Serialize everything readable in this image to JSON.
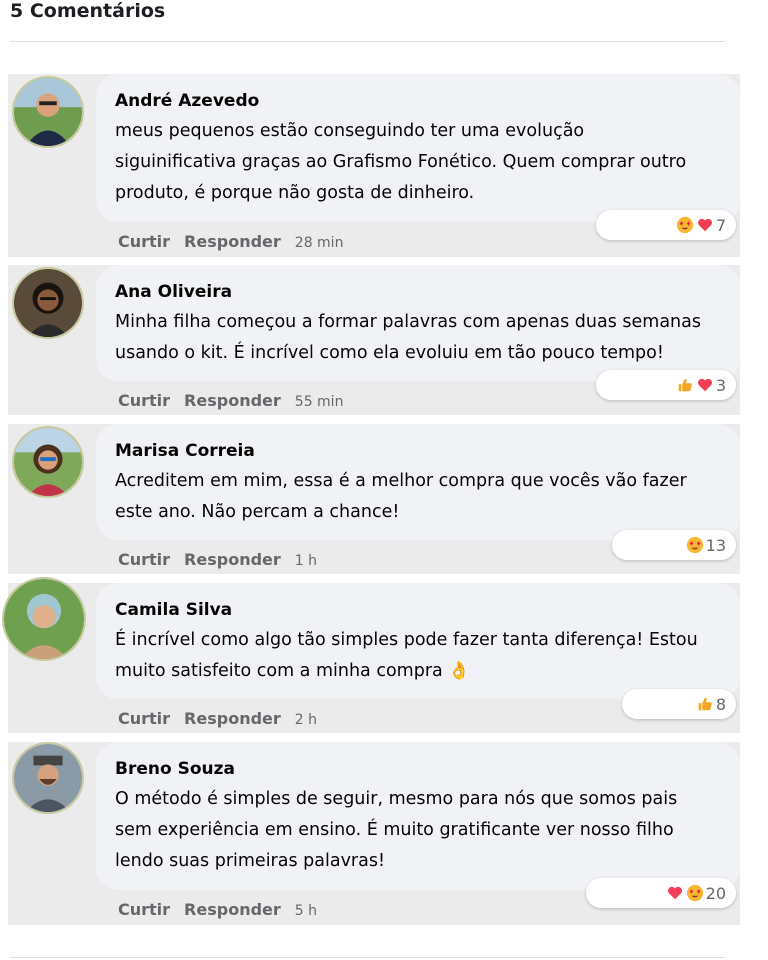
{
  "header": {
    "title": "5 Comentários"
  },
  "actions": {
    "like": "Curtir",
    "reply": "Responder"
  },
  "comments": [
    {
      "name": "André Azevedo",
      "lines": [
        "meus pequenos estão conseguindo ter uma evolução",
        "siguinificativa graças ao Grafismo Fonético. Quem comprar outro",
        "produto, é porque não gosta de dinheiro."
      ],
      "time": "28 min",
      "reactions": [
        "heart-eyes-emoji",
        "heart-icon"
      ],
      "count": "7"
    },
    {
      "name": "Ana Oliveira",
      "lines": [
        "Minha filha começou a formar palavras com apenas duas semanas",
        "usando o kit. É incrível como ela evoluiu em tão pouco tempo!"
      ],
      "time": "55 min",
      "reactions": [
        "thumbs-up-icon",
        "heart-icon"
      ],
      "count": "3"
    },
    {
      "name": "Marisa Correia",
      "lines": [
        "Acreditem em mim, essa é a melhor compra que vocês vão fazer",
        "este ano. Não percam a chance!"
      ],
      "time": "1 h",
      "reactions": [
        "heart-eyes-emoji"
      ],
      "count": "13"
    },
    {
      "name": "Camila Silva",
      "lines": [
        "É incrível como algo tão simples pode fazer tanta diferença! Estou",
        "muito satisfeito com a minha compra 👌"
      ],
      "time": "2 h",
      "reactions": [
        "thumbs-up-icon"
      ],
      "count": "8"
    },
    {
      "name": "Breno Souza",
      "lines": [
        "O método é simples de seguir, mesmo para nós que somos pais",
        "sem experiência em ensino. É muito gratificante ver nosso filho",
        "lendo suas primeiras palavras!"
      ],
      "time": "5 h",
      "reactions": [
        "heart-icon",
        "heart-eyes-emoji"
      ],
      "count": "20"
    }
  ],
  "colors": {
    "bubble": "#f0f2f5",
    "panel": "#ebebeb",
    "meta": "#65676b",
    "heart": "#f33e58",
    "like": "#f5a623"
  }
}
